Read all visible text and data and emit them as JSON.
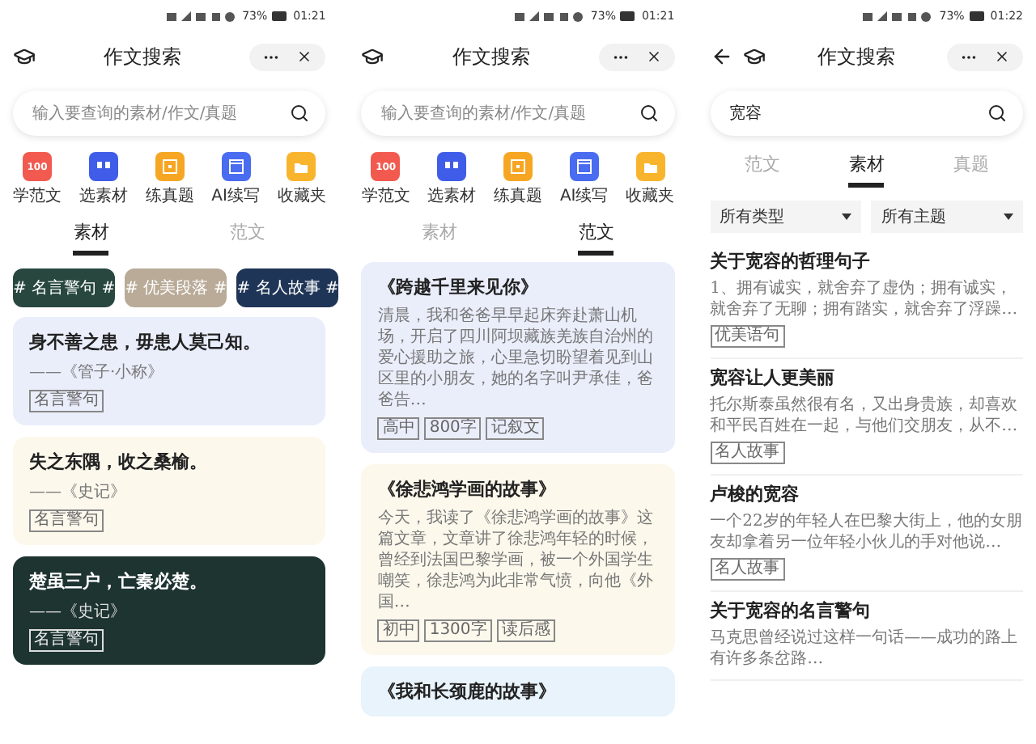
{
  "screens": [
    {
      "status": {
        "battery": "73%",
        "time": "01:21"
      },
      "header": {
        "back": false,
        "title": "作文搜索"
      },
      "search": {
        "placeholder": "输入要查询的素材/作文/真题"
      },
      "shortcuts": [
        {
          "kind": "score",
          "badge": "100",
          "label": "学范文",
          "color": "#f25a4f"
        },
        {
          "kind": "quote",
          "label": "选素材",
          "color": "#3f5de8"
        },
        {
          "kind": "box",
          "label": "练真题",
          "color": "#f6a623"
        },
        {
          "kind": "window",
          "label": "AI续写",
          "color": "#4a6cf0"
        },
        {
          "kind": "folder",
          "label": "收藏夹",
          "color": "#f9b42d"
        }
      ],
      "tabs": [
        {
          "label": "素材",
          "selected": true
        },
        {
          "label": "范文",
          "selected": false
        }
      ],
      "chips": [
        {
          "label": "# 名言警句 #",
          "color": "#27473f"
        },
        {
          "label": "# 优美段落 #",
          "color": "#b9ab98"
        },
        {
          "label": "# 名人故事 #",
          "color": "#1f3557"
        }
      ],
      "cards": [
        {
          "kind": "quote",
          "dark": false,
          "color": "#eaeefb",
          "title": "身不善之患，毋患人莫己知。",
          "source": "——《管子·小称》",
          "tags": [
            "名言警句"
          ]
        },
        {
          "kind": "quote",
          "dark": false,
          "color": "#fdf8ec",
          "title": "失之东隅，收之桑榆。",
          "source": "——《史记》",
          "tags": [
            "名言警句"
          ]
        },
        {
          "kind": "quote",
          "dark": true,
          "color": "#1e3431",
          "title": "楚虽三户，亡秦必楚。",
          "source": "——《史记》",
          "tags": [
            "名言警句"
          ]
        }
      ]
    },
    {
      "status": {
        "battery": "73%",
        "time": "01:21"
      },
      "header": {
        "back": false,
        "title": "作文搜索"
      },
      "search": {
        "placeholder": "输入要查询的素材/作文/真题"
      },
      "shortcuts": [
        {
          "kind": "score",
          "badge": "100",
          "label": "学范文",
          "color": "#f25a4f"
        },
        {
          "kind": "quote",
          "label": "选素材",
          "color": "#3f5de8"
        },
        {
          "kind": "box",
          "label": "练真题",
          "color": "#f6a623"
        },
        {
          "kind": "window",
          "label": "AI续写",
          "color": "#4a6cf0"
        },
        {
          "kind": "folder",
          "label": "收藏夹",
          "color": "#f9b42d"
        }
      ],
      "tabs": [
        {
          "label": "素材",
          "selected": false
        },
        {
          "label": "范文",
          "selected": true
        }
      ],
      "cards": [
        {
          "kind": "essay",
          "dark": false,
          "color": "#eaeefb",
          "title": "《跨越千里来见你》",
          "text": "清晨，我和爸爸早早起床奔赴萧山机场，开启了四川阿坝藏族羌族自治州的爱心援助之旅，心里急切盼望着见到山区里的小朋友，她的名字叫尹承佳，爸爸告…",
          "tags": [
            "高中",
            "800字",
            "记叙文"
          ]
        },
        {
          "kind": "essay",
          "dark": false,
          "color": "#fdf8ec",
          "title": "《徐悲鸿学画的故事》",
          "text": "今天，我读了《徐悲鸿学画的故事》这篇文章，文章讲了徐悲鸿年轻的时候，曾经到法国巴黎学画，被一个外国学生嘲笑，徐悲鸿为此非常气愤，向他《外国…",
          "tags": [
            "初中",
            "1300字",
            "读后感"
          ]
        },
        {
          "kind": "essay",
          "dark": false,
          "color": "#e8f3fb",
          "title": "《我和长颈鹿的故事》"
        }
      ]
    },
    {
      "status": {
        "battery": "73%",
        "time": "01:22"
      },
      "header": {
        "back": true,
        "title": "作文搜索"
      },
      "search": {
        "value": "宽容"
      },
      "tabs": [
        {
          "label": "范文",
          "selected": false
        },
        {
          "label": "素材",
          "selected": true
        },
        {
          "label": "真题",
          "selected": false
        }
      ],
      "filters": [
        "所有类型",
        "所有主题"
      ],
      "cards": [
        {
          "kind": "result",
          "title": "关于宽容的哲理句子",
          "text": "1、拥有诚实，就舍弃了虚伪；拥有诚实，就舍弃了无聊；拥有踏实，就舍弃了浮躁…",
          "tags": [
            "优美语句"
          ]
        },
        {
          "kind": "result",
          "title": "宽容让人更美丽",
          "text": "托尔斯泰虽然很有名，又出身贵族，却喜欢和平民百姓在一起，与他们交朋友，从不…",
          "tags": [
            "名人故事"
          ]
        },
        {
          "kind": "result",
          "title": "卢梭的宽容",
          "text": "一个22岁的年轻人在巴黎大街上，他的女朋友却拿着另一位年轻小伙儿的手对他说…",
          "tags": [
            "名人故事"
          ]
        },
        {
          "kind": "result",
          "title": "关于宽容的名言警句",
          "text": "马克思曾经说过这样一句话——成功的路上有许多条岔路…"
        }
      ]
    }
  ]
}
